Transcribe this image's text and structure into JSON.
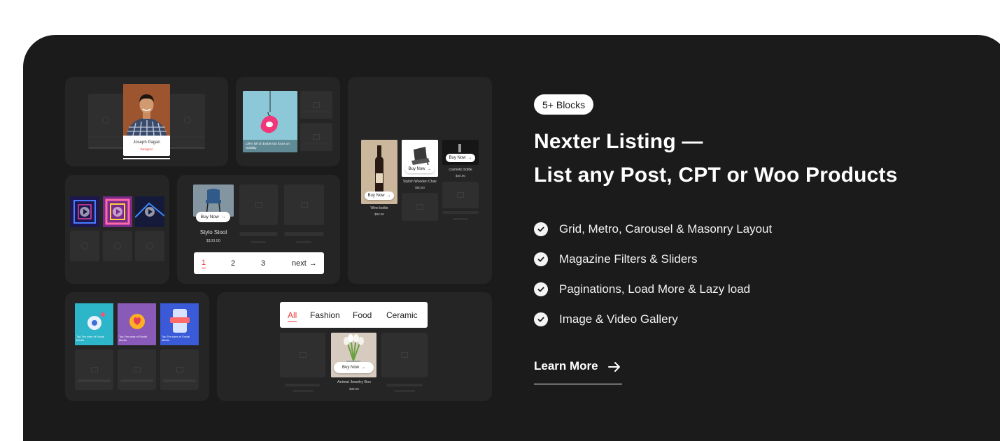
{
  "badge": "5+ Blocks",
  "headline": {
    "line1": "Nexter Listing —",
    "line2": "List any Post, CPT or Woo Products"
  },
  "features": [
    {
      "icon": "check-circle-icon",
      "label": "Grid, Metro, Carousel & Masonry Layout"
    },
    {
      "icon": "check-circle-icon",
      "label": "Magazine Filters & Sliders"
    },
    {
      "icon": "check-circle-icon",
      "label": "Paginations, Load More & Lazy load"
    },
    {
      "icon": "check-circle-icon",
      "label": "Image & Video Gallery"
    }
  ],
  "cta": {
    "label": "Learn More",
    "icon": "arrow-right-icon"
  },
  "preview": {
    "profile_card": {
      "name": "Joseph Pagan",
      "role": "Designer"
    },
    "post_card": {
      "caption": "Life's full of doubts but focus on visibility"
    },
    "buy_label": "Buy Now",
    "products": [
      {
        "name": "Wine bottle",
        "price": "$90.00"
      },
      {
        "name": "Stylish Wooden Chair",
        "price": "$80.00"
      },
      {
        "name": "cosmetic bottle",
        "price": "$40.00"
      }
    ],
    "stool": {
      "name": "Stylo Stool",
      "price": "$100.00"
    },
    "pagination": {
      "pages": [
        "1",
        "2",
        "3"
      ],
      "next": "next"
    },
    "social_cards": [
      {
        "title": "Top Ten uses of Social Media",
        "tag": "Social"
      },
      {
        "title": "Top Ten uses of Social Media",
        "tag": "Social"
      },
      {
        "title": "Top Ten uses of Social Media",
        "tag": "Social"
      }
    ],
    "filter_tabs": [
      "All",
      "Fashion",
      "Food",
      "Ceramic"
    ],
    "jewelry": {
      "name": "Animal Jewelry Box",
      "price": "$39.00"
    }
  },
  "colors": {
    "panel_bg": "#1b1b1b",
    "tile_bg": "#252525",
    "accent_red": "#e8403c",
    "text_white": "#ffffff"
  }
}
